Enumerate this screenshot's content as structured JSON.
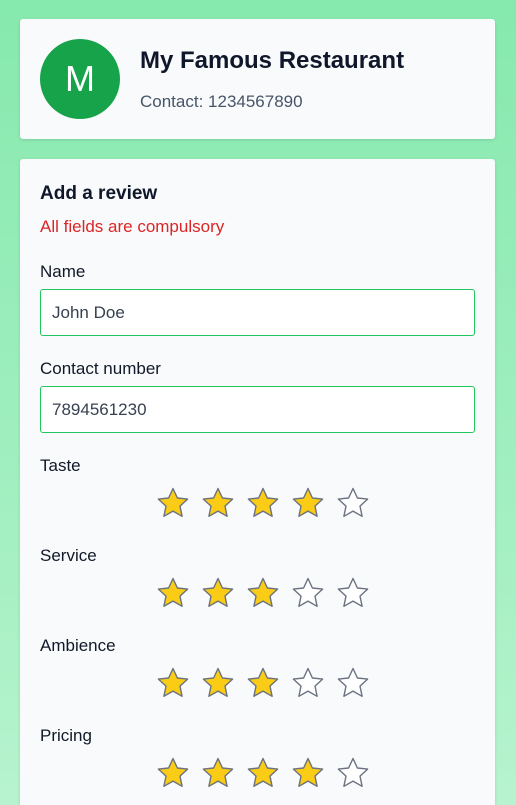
{
  "header": {
    "avatar_letter": "M",
    "restaurant_name": "My Famous Restaurant",
    "contact": "Contact: 1234567890"
  },
  "form": {
    "title": "Add a review",
    "note": "All fields are compulsory",
    "name": {
      "label": "Name",
      "value": "John Doe"
    },
    "phone": {
      "label": "Contact number",
      "value": "7894561230"
    },
    "ratings": [
      {
        "label": "Taste",
        "value": 4,
        "max": 5
      },
      {
        "label": "Service",
        "value": 3,
        "max": 5
      },
      {
        "label": "Ambience",
        "value": 3,
        "max": 5
      },
      {
        "label": "Pricing",
        "value": 4,
        "max": 5
      }
    ]
  },
  "colors": {
    "accent": "#16a34a",
    "error": "#dc2626",
    "star_filled": "#facc15",
    "star_stroke": "#6b7280"
  },
  "icons": {
    "rating": "star-icon"
  }
}
